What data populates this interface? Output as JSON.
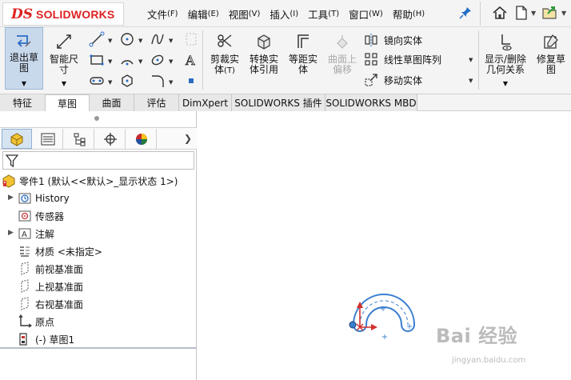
{
  "app": {
    "brand_mark": "DS",
    "brand_name": "SOLIDWORKS"
  },
  "menu": [
    {
      "label": "文件",
      "accel": "(F)"
    },
    {
      "label": "编辑",
      "accel": "(E)"
    },
    {
      "label": "视图",
      "accel": "(V)"
    },
    {
      "label": "插入",
      "accel": "(I)"
    },
    {
      "label": "工具",
      "accel": "(T)"
    },
    {
      "label": "窗口",
      "accel": "(W)"
    },
    {
      "label": "帮助",
      "accel": "(H)"
    }
  ],
  "quick_access_icons": [
    "pin-icon",
    "home-icon",
    "new-document-icon",
    "open-icon"
  ],
  "ribbon": {
    "exit_sketch": "退出草图",
    "smart_dimension": "智能尺寸",
    "trim": "剪裁实体",
    "trim_accel": "(T)",
    "convert": "转换实体引用",
    "offset": "等距实体",
    "surface_offset": "曲面上偏移",
    "mirror": "镜向实体",
    "linear_pattern": "线性草图阵列",
    "move": "移动实体",
    "show_delete_relations": "显示/删除几何关系",
    "repair_sketch": "修复草图"
  },
  "tabs": [
    {
      "label": "特征",
      "active": false
    },
    {
      "label": "草图",
      "active": true
    },
    {
      "label": "曲面",
      "active": false
    },
    {
      "label": "评估",
      "active": false
    },
    {
      "label": "DimXpert",
      "active": false
    },
    {
      "label": "SOLIDWORKS 插件",
      "active": false
    },
    {
      "label": "SOLIDWORKS MBD",
      "active": false
    }
  ],
  "feature_manager": {
    "root": "零件1 (默认<<默认>_显示状态 1>)",
    "items": [
      {
        "label": "History",
        "icon": "history-icon",
        "expandable": true
      },
      {
        "label": "传感器",
        "icon": "sensor-icon",
        "expandable": false
      },
      {
        "label": "注解",
        "icon": "annotation-icon",
        "expandable": true
      },
      {
        "label": "材质 <未指定>",
        "icon": "material-icon",
        "expandable": false
      },
      {
        "label": "前视基准面",
        "icon": "plane-icon",
        "expandable": false
      },
      {
        "label": "上视基准面",
        "icon": "plane-icon",
        "expandable": false
      },
      {
        "label": "右视基准面",
        "icon": "plane-icon",
        "expandable": false
      },
      {
        "label": "原点",
        "icon": "origin-icon",
        "expandable": false
      },
      {
        "label": "(-) 草图1",
        "icon": "sketch-icon",
        "expandable": false
      }
    ]
  },
  "watermark": {
    "text": "Bai 经验",
    "sub": "jingyan.baidu.com"
  },
  "colors": {
    "brand_red": "#d22222",
    "sketch_blue": "#3a7fd0",
    "active_blue": "#c9d9ec"
  }
}
